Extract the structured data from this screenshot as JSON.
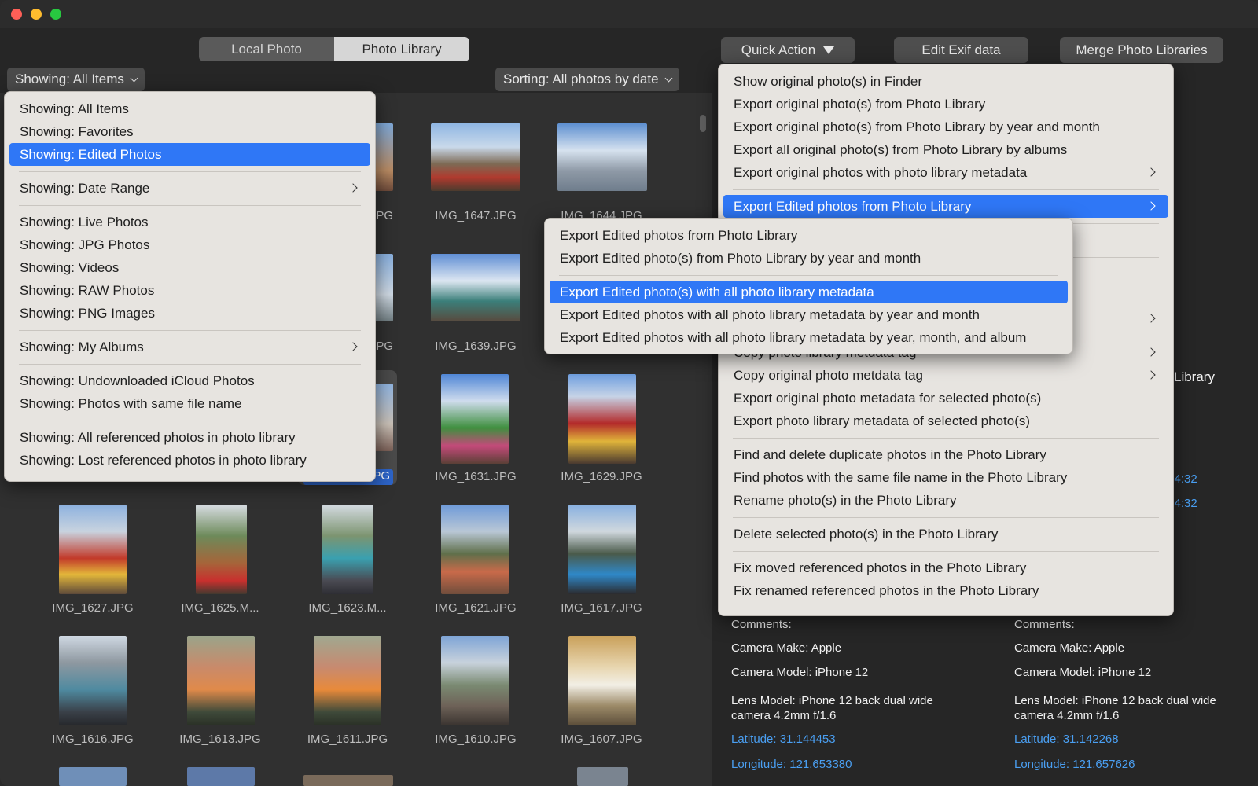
{
  "tabs": {
    "local": "Local Photo",
    "library": "Photo Library"
  },
  "toolbar": {
    "quick_action": "Quick Action",
    "edit_exif": "Edit Exif data",
    "merge": "Merge Photo Libraries"
  },
  "filter": {
    "showing": "Showing: All Items",
    "sorting": "Sorting: All photos by date"
  },
  "show_menu": {
    "items": [
      "Showing: All Items",
      "Showing: Favorites",
      "Showing: Edited Photos",
      "Showing: Date Range",
      "Showing: Live Photos",
      "Showing: JPG Photos",
      "Showing: Videos",
      "Showing: RAW Photos",
      "Showing: PNG Images",
      "Showing: My Albums",
      "Showing: Undownloaded iCloud Photos",
      "Showing: Photos with same file name",
      "Showing: All referenced photos in photo library",
      "Showing: Lost referenced photos in photo library"
    ]
  },
  "quick_menu": {
    "items": [
      "Show original photo(s) in Finder",
      "Export original photo(s) from Photo Library",
      "Export original photo(s) from Photo Library by year and month",
      "Export all original photo(s) from Photo Library by albums",
      "Export original photos with photo library metadata",
      "Export Edited photos from Photo Library",
      "Copy photo library metdata tag",
      "Copy original photo metdata tag",
      "Export original photo metadata for selected photo(s)",
      "Export photo library metadata of selected photo(s)",
      "Find and delete duplicate photos in the Photo Library",
      "Find photos with the same file name in the Photo Library",
      "Rename photo(s) in the Photo Library",
      "Delete selected photo(s) in the Photo Library",
      "Fix moved referenced photos in the Photo Library",
      "Fix renamed referenced photos in the Photo Library"
    ]
  },
  "sub_menu": {
    "items": [
      "Export Edited photos from Photo Library",
      "Export Edited photo(s) from Photo Library by year and month",
      "Export Edited photo(s) with all photo library metadata",
      "Export Edited photos with all photo library metadata by year and month",
      "Export Edited photos with all photo library metadata by year, month, and album"
    ]
  },
  "grid": {
    "labels": [
      "PG",
      "IMG_1647.JPG",
      "IMG_1644.JPG",
      "PG",
      "IMG_1639.JPG",
      "PG",
      "IMG_1631.JPG",
      "IMG_1629.JPG",
      "IMG_1627.JPG",
      "IMG_1625.M...",
      "IMG_1623.M...",
      "IMG_1621.JPG",
      "IMG_1617.JPG",
      "IMG_1616.JPG",
      "IMG_1613.JPG",
      "IMG_1611.JPG",
      "IMG_1610.JPG",
      "IMG_1607.JPG"
    ]
  },
  "details": {
    "partial_library": "Library",
    "partial_time_1": ":24:32",
    "partial_time_2": ":24:32",
    "col1": {
      "comments": "Comments:",
      "make": "Camera Make: Apple",
      "model": "Camera Model: iPhone 12",
      "lens": "Lens Model: iPhone 12 back dual wide camera 4.2mm f/1.6",
      "lat": "Latitude: 31.144453",
      "lon": "Longitude: 121.653380"
    },
    "col2": {
      "comments": "Comments:",
      "make": "Camera Make: Apple",
      "model": "Camera Model: iPhone 12",
      "lens": "Lens Model: iPhone 12 back dual wide camera 4.2mm f/1.6",
      "lat": "Latitude: 31.142268",
      "lon": "Longitude: 121.657626"
    }
  },
  "colors": {
    "accent": "#2f77f6",
    "link": "#4a9ff2",
    "menu_bg": "#e7e4e0"
  }
}
